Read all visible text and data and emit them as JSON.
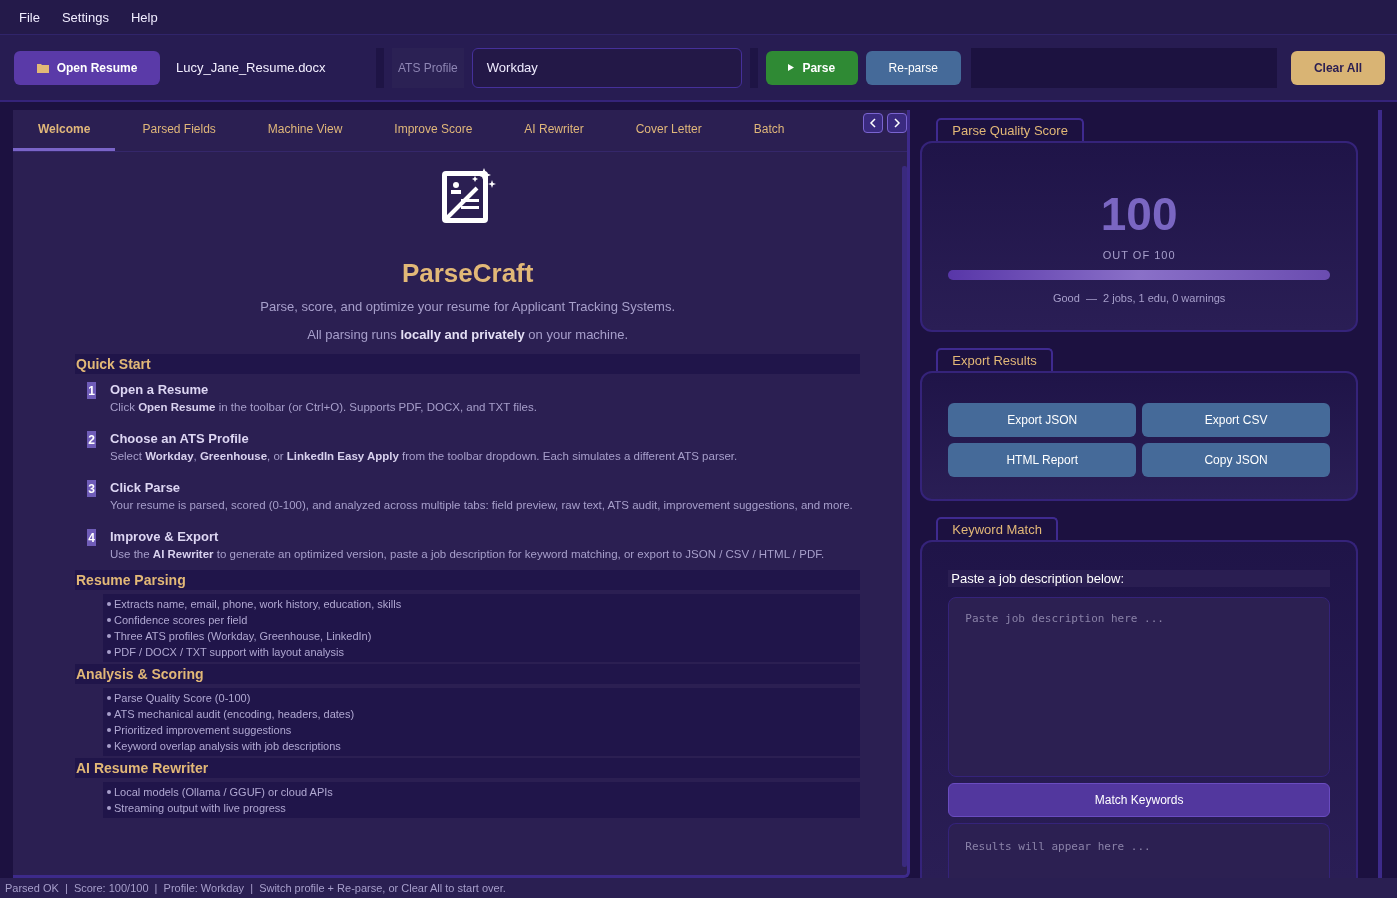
{
  "menu": [
    "File",
    "Settings",
    "Help"
  ],
  "toolbar": {
    "open_button": "Open Resume",
    "file_name": "Lucy_Jane_Resume.docx",
    "ats_label": "ATS Profile",
    "ats_profile": "Workday",
    "parse_button": "Parse",
    "reparse_button": "Re-parse",
    "clear_button": "Clear All"
  },
  "tabs": [
    {
      "label": "Welcome",
      "selected": true
    },
    {
      "label": "Parsed Fields",
      "selected": false
    },
    {
      "label": "Machine View",
      "selected": false
    },
    {
      "label": "Improve Score",
      "selected": false
    },
    {
      "label": "AI Rewriter",
      "selected": false
    },
    {
      "label": "Cover Letter",
      "selected": false
    },
    {
      "label": "Batch",
      "selected": false
    }
  ],
  "welcome": {
    "title": "ParseCraft",
    "tagline": "Parse, score, and optimize your resume for Applicant Tracking Systems.",
    "privacy": "All parsing runs **locally and privately** on your machine.",
    "quick_start": "Quick Start",
    "steps": [
      {
        "number": "1",
        "title": "Open a Resume",
        "text": "Click **Open Resume** in the toolbar (or Ctrl+O). Supports PDF, DOCX, and TXT files."
      },
      {
        "number": "2",
        "title": "Choose an ATS Profile",
        "text": "Select **Workday**, **Greenhouse**, or **LinkedIn Easy Apply** from the toolbar dropdown. Each simulates a different ATS parser."
      },
      {
        "number": "3",
        "title": "Click Parse",
        "text": "Your resume is parsed, scored (0-100), and analyzed across multiple tabs: field preview, raw text, ATS audit, improvement suggestions, and more."
      },
      {
        "number": "4",
        "title": "Improve & Export",
        "text": "Use the **AI Rewriter** to generate an optimized version, paste a job description for keyword matching, or export to JSON / CSV / HTML / PDF."
      }
    ],
    "sections": [
      {
        "heading": "Resume Parsing",
        "items": [
          "Extracts name, email, phone, work history, education, skills",
          "Confidence scores per field",
          "Three ATS profiles (Workday, Greenhouse, LinkedIn)",
          "PDF / DOCX / TXT support with layout analysis"
        ]
      },
      {
        "heading": "Analysis & Scoring",
        "items": [
          "Parse Quality Score (0-100)",
          "ATS mechanical audit (encoding, headers, dates)",
          "Prioritized improvement suggestions",
          "Keyword overlap analysis with job descriptions"
        ]
      },
      {
        "heading": "AI Resume Rewriter",
        "items": [
          "Local models (Ollama / GGUF) or cloud APIs",
          "Streaming output with live progress"
        ]
      }
    ]
  },
  "score_card": {
    "title": "Parse Quality Score",
    "score": "100",
    "out_of": "OUT OF 100",
    "level": 1,
    "summary": "Good  —  2 jobs, 1 edu, 0 warnings"
  },
  "export": {
    "title": "Export Results",
    "buttons": [
      "Export JSON",
      "Export CSV",
      "HTML Report",
      "Copy JSON"
    ]
  },
  "keyword": {
    "title": "Keyword Match",
    "label": "Paste a job description below:",
    "placeholder": "Paste job description here ...",
    "button": "Match Keywords",
    "results_placeholder": "Results will appear here ..."
  },
  "status_bar": "Parsed OK  |  Score: 100/100  |  Profile: Workday  |  Switch profile + Re-parse, or Clear All to start over."
}
